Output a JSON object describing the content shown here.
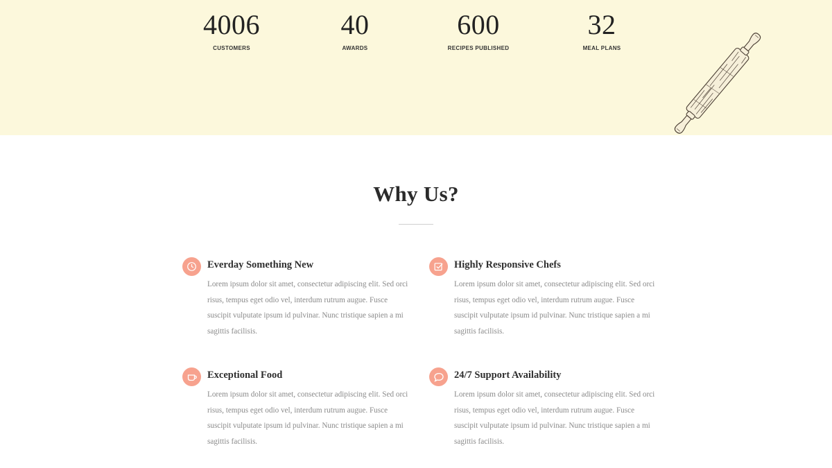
{
  "stats": [
    {
      "value": "4006",
      "label": "CUSTOMERS"
    },
    {
      "value": "40",
      "label": "AWARDS"
    },
    {
      "value": "600",
      "label": "RECIPES PUBLISHED"
    },
    {
      "value": "32",
      "label": "MEAL PLANS"
    }
  ],
  "section": {
    "title": "Why Us?"
  },
  "features": [
    {
      "icon": "clock-icon",
      "title": "Everday Something New",
      "text": "Lorem ipsum dolor sit amet, consectetur adipiscing elit. Sed orci risus, tempus eget odio vel, interdum rutrum augue. Fusce suscipit vulputate ipsum id pulvinar. Nunc tristique sapien a mi sagittis facilisis."
    },
    {
      "icon": "checkbox-icon",
      "title": "Highly Responsive Chefs",
      "text": "Lorem ipsum dolor sit amet, consectetur adipiscing elit. Sed orci risus, tempus eget odio vel, interdum rutrum augue. Fusce suscipit vulputate ipsum id pulvinar. Nunc tristique sapien a mi sagittis facilisis."
    },
    {
      "icon": "cup-icon",
      "title": "Exceptional Food",
      "text": "Lorem ipsum dolor sit amet, consectetur adipiscing elit. Sed orci risus, tempus eget odio vel, interdum rutrum augue. Fusce suscipit vulputate ipsum id pulvinar. Nunc tristique sapien a mi sagittis facilisis."
    },
    {
      "icon": "chat-bubble-icon",
      "title": "24/7 Support Availability",
      "text": "Lorem ipsum dolor sit amet, consectetur adipiscing elit. Sed orci risus, tempus eget odio vel, interdum rutrum augue. Fusce suscipit vulputate ipsum id pulvinar. Nunc tristique sapien a mi sagittis facilisis."
    }
  ],
  "colors": {
    "band_background": "#fcf8dc",
    "icon_accent": "#f7a28e",
    "body_text": "#8a8a8a",
    "heading_text": "#2b2b2b"
  }
}
